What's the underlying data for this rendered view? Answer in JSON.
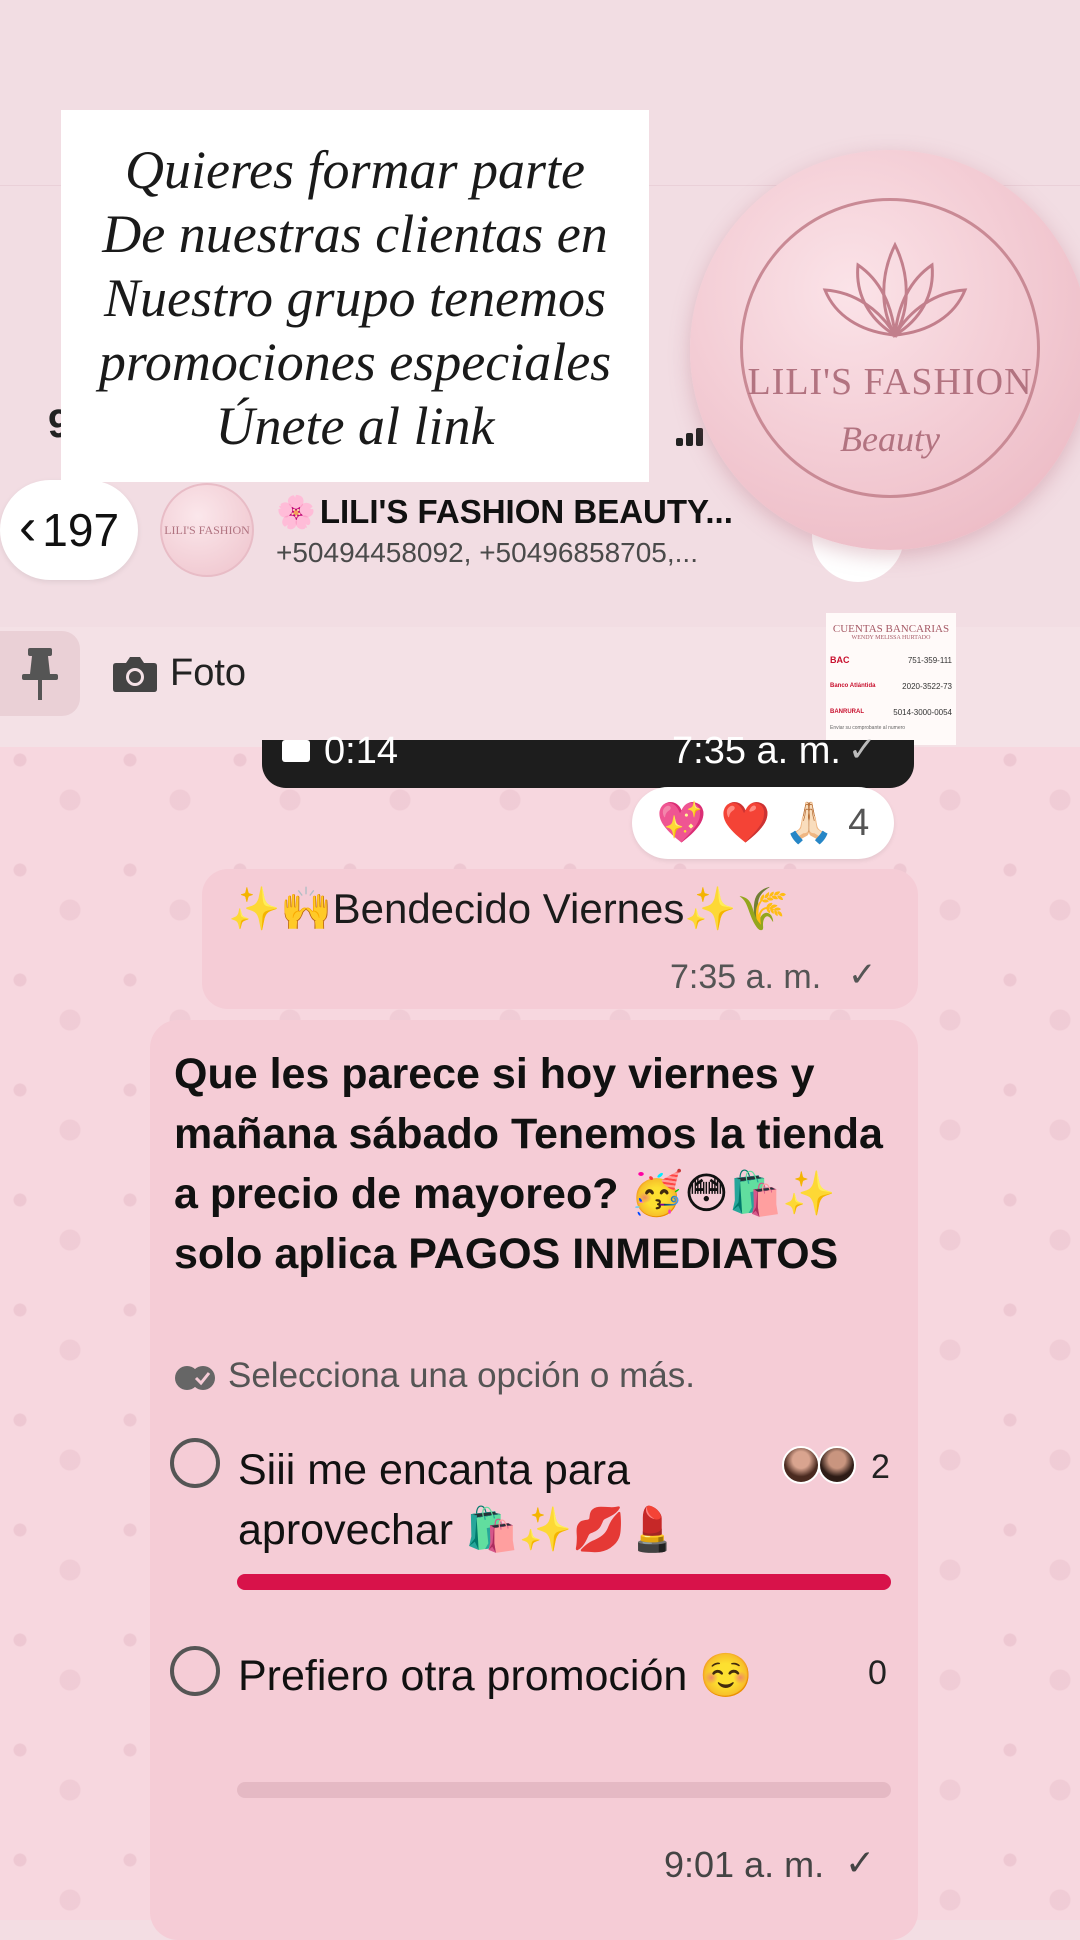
{
  "promo": {
    "lines": [
      "Quieres formar parte",
      "De nuestras clientas en",
      "Nuestro grupo tenemos",
      "promociones especiales",
      "Únete al link"
    ]
  },
  "logo": {
    "title": "LILI'S FASHION",
    "subtitle": "Beauty"
  },
  "status_bar": {
    "partial_text": "9"
  },
  "header": {
    "back_count": "197",
    "avatar_text": "LILI'S FASHION",
    "group_name": "LILI'S FASHION BEAUTY...",
    "group_icon": "🌸",
    "members": "+50494458092, +50496858705,..."
  },
  "pinned": {
    "label": "Foto",
    "thumb": {
      "title": "CUENTAS BANCARIAS",
      "owner": "WENDY MELISSA HURTADO",
      "rows": [
        {
          "bank": "BAC",
          "number": "751-359-111"
        },
        {
          "bank": "Banco Atlántida",
          "number": "2020-3522-73"
        },
        {
          "bank": "BANRURAL",
          "number": "5014-3000-0054"
        }
      ],
      "footer": "Enviar su comprobante al numero"
    }
  },
  "video": {
    "duration": "0:14",
    "time": "7:35 a. m."
  },
  "reactions": {
    "emojis": [
      "💖",
      "❤️",
      "🙏🏻"
    ],
    "count": "4"
  },
  "message1": {
    "text": "✨🙌Bendecido Viernes✨🌾",
    "time": "7:35 a. m."
  },
  "poll": {
    "question": "Que les parece si hoy viernes y mañana sábado Tenemos la tienda a precio de mayoreo? 🥳😳🛍️✨ solo aplica PAGOS INMEDIATOS",
    "hint": "Selecciona una opción o más.",
    "options": [
      {
        "text": "Siii me encanta para aprovechar 🛍️✨💋💄",
        "votes": "2",
        "fraction": 1.0
      },
      {
        "text": "Prefiero otra promoción ☺️",
        "votes": "0",
        "fraction": 0.0
      }
    ],
    "time": "9:01 a. m."
  },
  "colors": {
    "accent": "#d8124a",
    "bubble": "#f5ccd6",
    "chat_background": "#f7d7df",
    "logo_rose": "#b27380"
  },
  "icons": [
    "chevron-left-icon",
    "pin-icon",
    "camera-icon",
    "video-icon",
    "check-icon",
    "double-check-icon",
    "lotus-icon"
  ]
}
